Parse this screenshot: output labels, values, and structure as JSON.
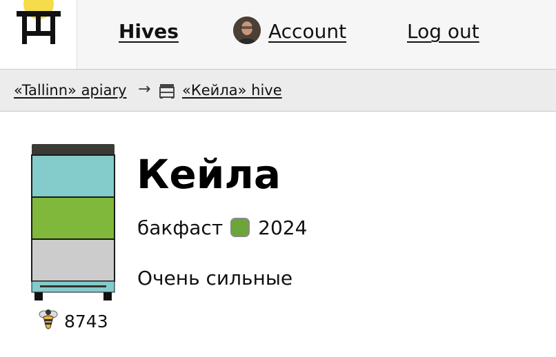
{
  "header": {
    "logo_icon": "beehive-logo-icon",
    "nav": {
      "hives_label": "Hives",
      "account_label": "Account",
      "logout_label": "Log out"
    },
    "avatar_icon": "user-avatar"
  },
  "breadcrumb": {
    "apiary_label": "«Tallinn» apiary",
    "separator": "→",
    "hive_icon": "hive-icon",
    "hive_label": "«Кейла» hive"
  },
  "hive": {
    "name": "Кейла",
    "breed": "бакфаст",
    "queen_color": "#6aa63a",
    "queen_year": "2024",
    "notes": "Очень сильные",
    "bee_icon": "bee-icon",
    "bee_count": "8743",
    "section_colors": [
      "#84cbcb",
      "#7fb83a",
      "#cccccc"
    ]
  }
}
